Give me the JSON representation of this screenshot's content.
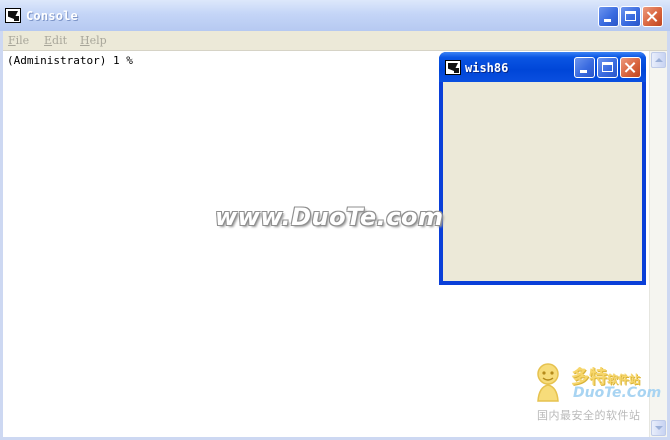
{
  "console": {
    "title": "Console",
    "icon": "tk-feather-icon",
    "menu": [
      {
        "label_first": "F",
        "label_rest": "ile"
      },
      {
        "label_first": "E",
        "label_rest": "dit"
      },
      {
        "label_first": "H",
        "label_rest": "elp"
      }
    ],
    "prompt_line": "(Administrator) 1 %",
    "colors": {
      "titlebar_inactive": "#c4d5f7",
      "menu_text_disabled": "#a8a69a",
      "client_bg": "#ffffff"
    }
  },
  "wish": {
    "title": "wish86",
    "icon": "tk-feather-icon",
    "colors": {
      "titlebar_active": "#0046d8",
      "client_bg": "#ece9d8"
    }
  },
  "caption_buttons": {
    "minimize_icon": "minimize-icon",
    "maximize_icon": "maximize-icon",
    "close_icon": "close-icon"
  },
  "watermark": {
    "center_text": "www.DuoTe.com",
    "brand": "多特",
    "brand_suffix": "软件站",
    "domain": "DuoTe.Com",
    "slogan": "国内最安全的软件站"
  }
}
